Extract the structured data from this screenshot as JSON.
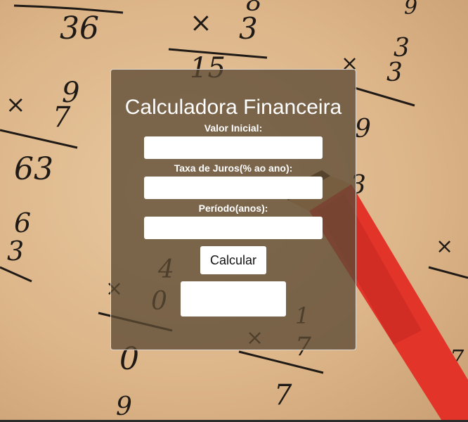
{
  "app": {
    "title": "Calculadora Financeira"
  },
  "form": {
    "initial_value_label": "Valor Inicial:",
    "initial_value": "",
    "interest_rate_label": "Taxa de Juros(% ao ano):",
    "interest_rate": "",
    "period_label": "Período(anos):",
    "period": "",
    "calculate_label": "Calcular",
    "result": ""
  },
  "colors": {
    "card_background": "#5c4a34",
    "card_border": "#ffffff",
    "text": "#ffffff",
    "pencil": "#e3342a"
  }
}
